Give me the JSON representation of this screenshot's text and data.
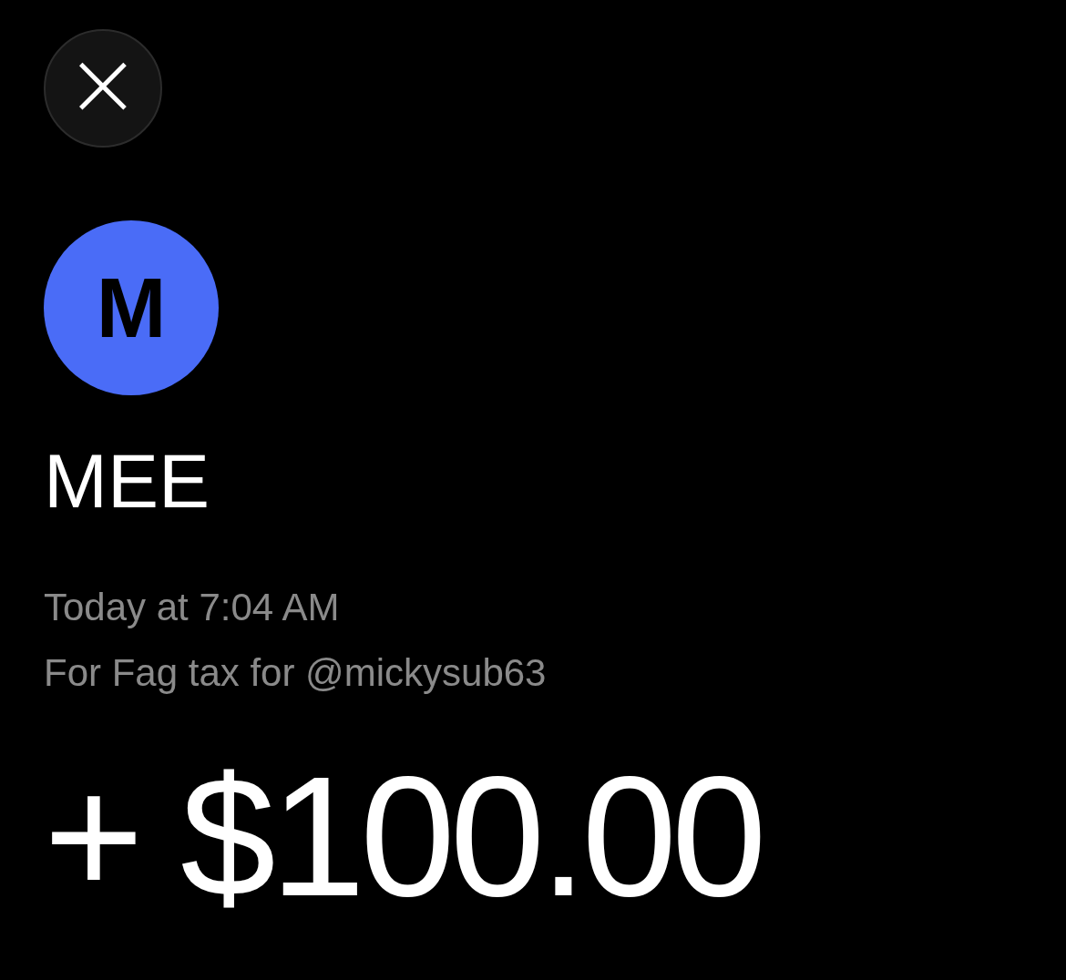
{
  "close_button": {
    "label": "×"
  },
  "avatar": {
    "initial": "M"
  },
  "name": "MEE",
  "timestamp": "Today at 7:04 AM",
  "note": "For Fag tax for @mickysub63",
  "amount": "+ $100.00"
}
